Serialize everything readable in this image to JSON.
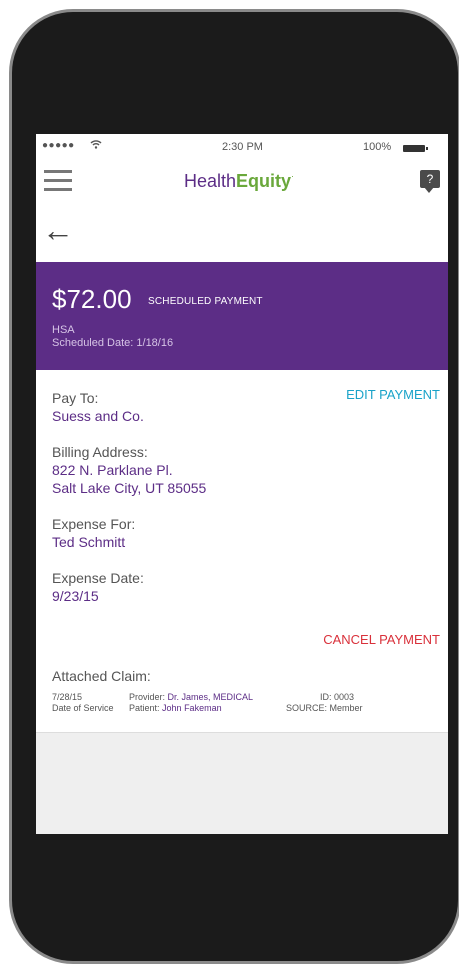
{
  "status_bar": {
    "signal": "●●●●●",
    "wifi_icon": "wifi-icon",
    "time": "2:30 PM",
    "battery": "100%"
  },
  "app_bar": {
    "brand_part1": "Health",
    "brand_part2": "Equity",
    "brand_mark": "·",
    "help_label": "?"
  },
  "back": {
    "icon": "←"
  },
  "payment": {
    "amount": "$72.00",
    "label": "SCHEDULED PAYMENT",
    "account": "HSA",
    "scheduled_date": "Scheduled Date: 1/18/16"
  },
  "details": {
    "edit_label": "EDIT PAYMENT",
    "pay_to_label": "Pay To:",
    "pay_to_value": "Suess and Co.",
    "billing_label": "Billing Address:",
    "billing_line1": "822 N. Parklane Pl.",
    "billing_line2": "Salt Lake City, UT 85055",
    "expense_for_label": "Expense For:",
    "expense_for_value": "Ted Schmitt",
    "expense_date_label": "Expense Date:",
    "expense_date_value": "9/23/15",
    "cancel_label": "CANCEL PAYMENT"
  },
  "claim": {
    "title": "Attached Claim:",
    "date": "7/28/15",
    "date_caption": "Date of Service",
    "provider_label": "Provider:",
    "provider_value": "Dr. James, MEDICAL",
    "patient_label": "Patient:",
    "patient_value": "John Fakeman",
    "id": "ID: 0003",
    "source": "SOURCE: Member"
  }
}
